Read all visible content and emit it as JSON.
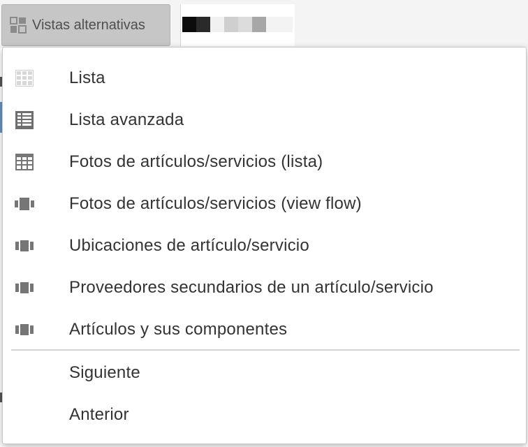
{
  "toolbar": {
    "alt_views_label": "Vistas alternativas",
    "alt_views_icon": "view-switch-icon"
  },
  "menu": {
    "view_items": [
      {
        "label": "Lista",
        "icon": "grid-light-icon"
      },
      {
        "label": "Lista avanzada",
        "icon": "grid-dense-icon"
      },
      {
        "label": "Fotos de artículos/servicios (lista)",
        "icon": "grid-icon"
      },
      {
        "label": "Fotos de artículos/servicios (view flow)",
        "icon": "flow-icon"
      },
      {
        "label": "Ubicaciones de artículo/servicio",
        "icon": "columns-icon"
      },
      {
        "label": "Proveedores secundarios de un artículo/servicio",
        "icon": "columns-icon"
      },
      {
        "label": "Artículos y sus componentes",
        "icon": "columns-icon"
      }
    ],
    "nav_items": [
      {
        "label": "Siguiente"
      },
      {
        "label": "Anterior"
      }
    ]
  },
  "colors": {
    "icon_light": "#c9c9c9",
    "icon_dark": "#6f6f6f",
    "button_bg": "#c6c6c6",
    "text": "#333333"
  }
}
